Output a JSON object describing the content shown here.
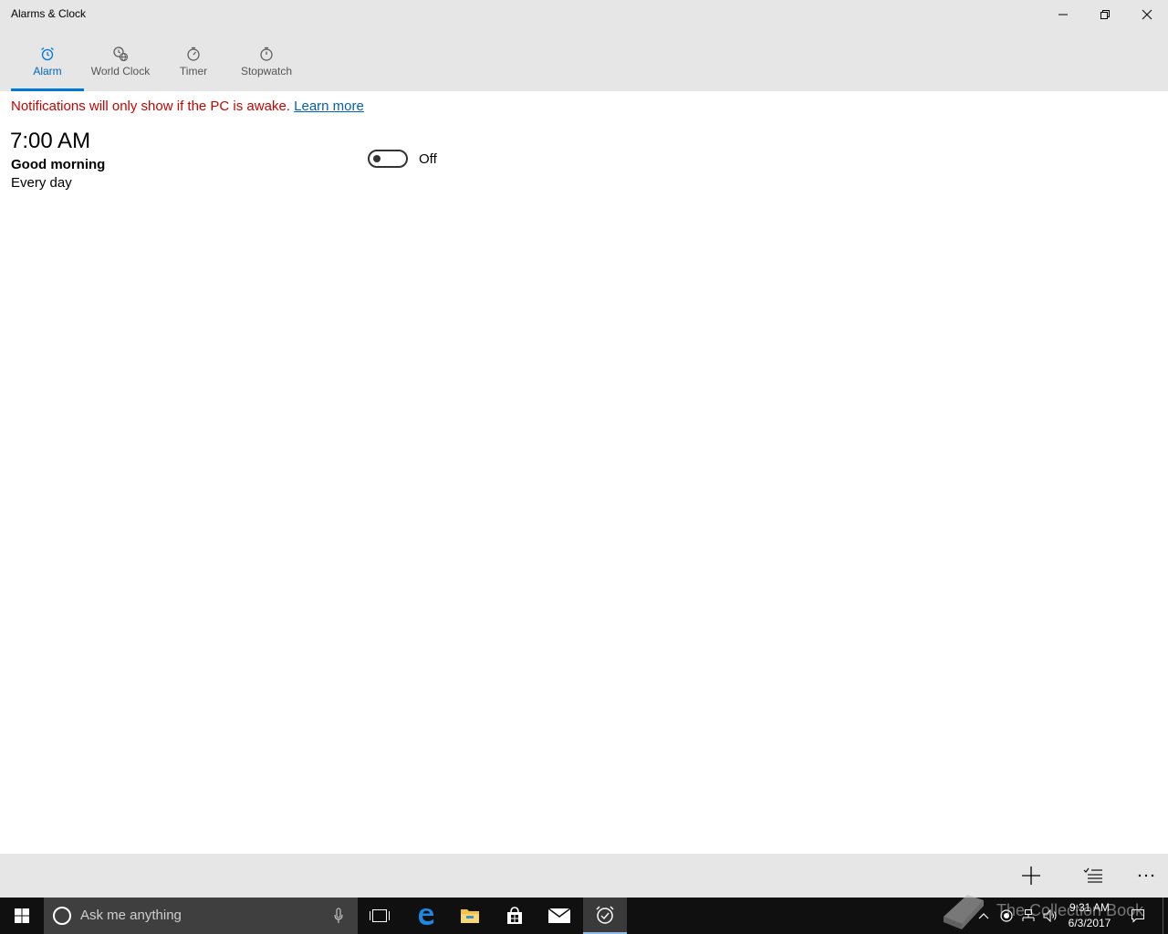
{
  "window": {
    "title": "Alarms & Clock",
    "controls": {
      "minimize": "minimize-icon",
      "restore": "restore-icon",
      "close": "close-icon"
    }
  },
  "tabs": [
    {
      "label": "Alarm",
      "icon": "alarm-clock-icon",
      "active": true
    },
    {
      "label": "World Clock",
      "icon": "world-clock-icon",
      "active": false
    },
    {
      "label": "Timer",
      "icon": "timer-icon",
      "active": false
    },
    {
      "label": "Stopwatch",
      "icon": "stopwatch-icon",
      "active": false
    }
  ],
  "notice": {
    "text": "Notifications will only show if the PC is awake.",
    "link": "Learn more"
  },
  "alarm": {
    "time": "7:00 AM",
    "name": "Good morning",
    "repeat": "Every day",
    "toggle_state": "Off"
  },
  "commandbar": {
    "buttons": [
      "add-icon",
      "select-alarms-icon",
      "more-icon"
    ]
  },
  "taskbar": {
    "search_placeholder": "Ask me anything",
    "apps": [
      "task-view-icon",
      "edge-icon",
      "file-explorer-icon",
      "store-icon",
      "mail-icon",
      "alarms-clock-icon"
    ],
    "time": "9:31 AM",
    "date": "6/3/2017"
  },
  "watermark": "The Collection Book",
  "colors": {
    "accent": "#0078d7",
    "notice_red": "#c50500",
    "link_blue": "#0063b1",
    "chrome_gray": "#e6e6e6",
    "taskbar": "#101010"
  }
}
